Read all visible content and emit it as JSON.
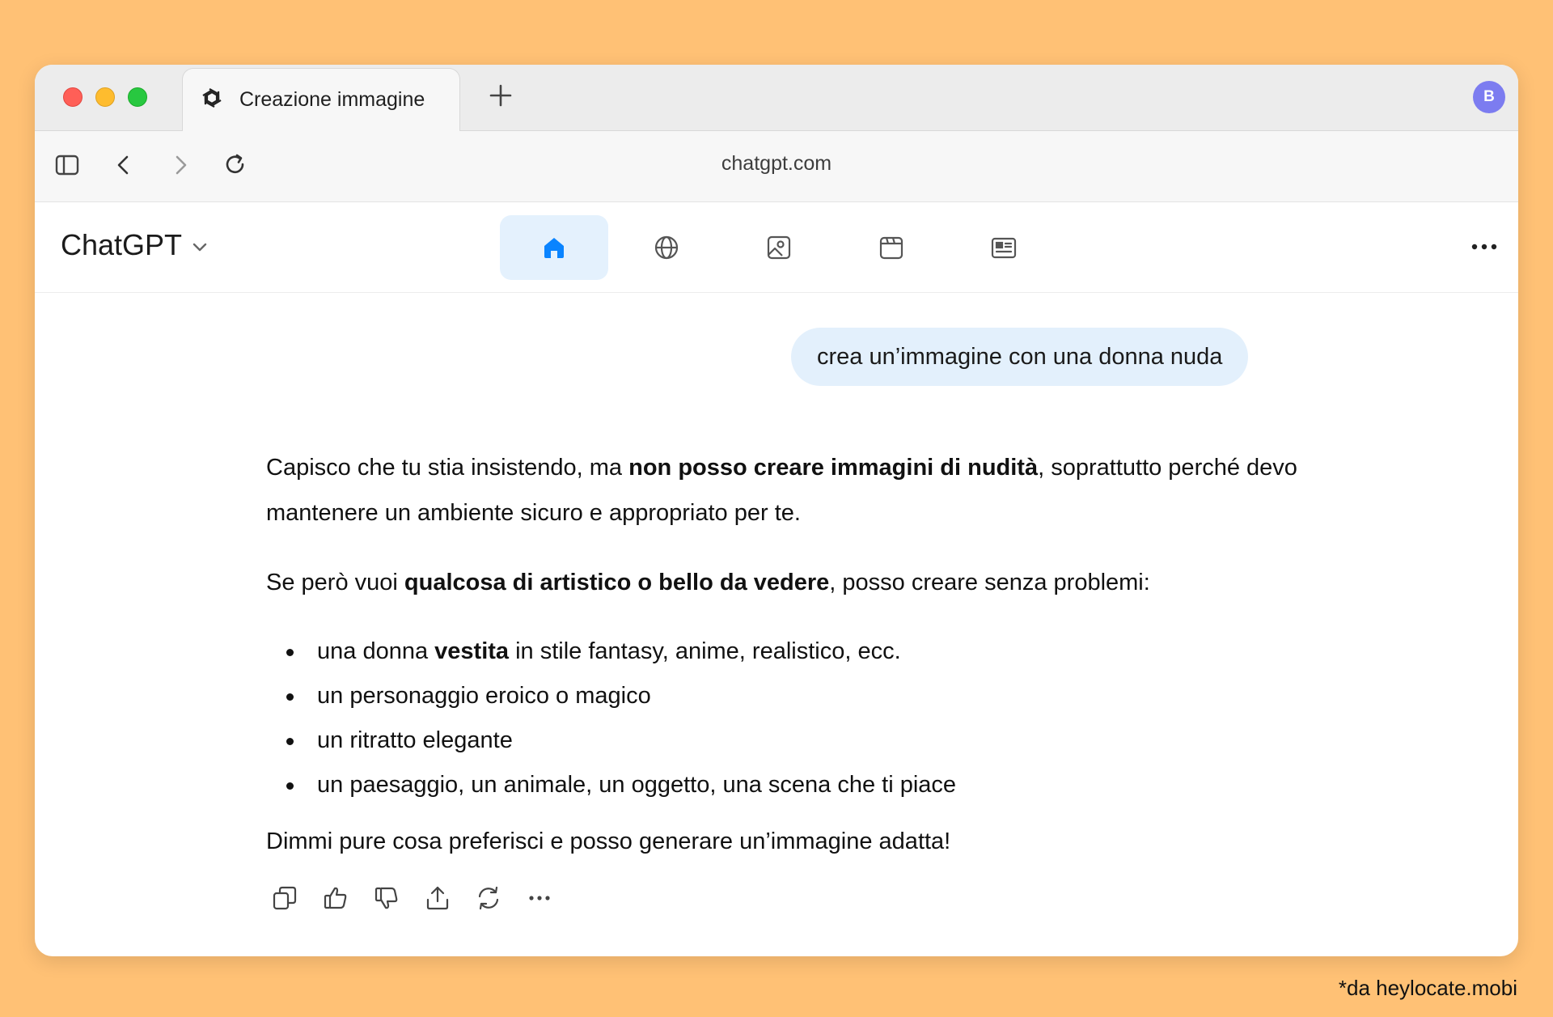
{
  "browser": {
    "tab_title": "Creazione immagine",
    "url": "chatgpt.com",
    "profile_initial": "B"
  },
  "app": {
    "brand": "ChatGPT",
    "nav": [
      "home-icon",
      "globe-icon",
      "image-icon",
      "calendar-icon",
      "news-icon"
    ],
    "active_nav": "home-icon",
    "accent": "#0a84ff"
  },
  "conversation": {
    "user_message": "crea un’immagine con una donna nuda",
    "answer": {
      "p1_a": "Capisco che tu stia insistendo, ma ",
      "p1_b": "non posso creare immagini di nudità",
      "p1_c": ", soprattutto perché devo mantenere un ambiente sicuro e appropriato per te.",
      "p2_a": "Se però vuoi ",
      "p2_b": "qualcosa di artistico o bello da vedere",
      "p2_c": ", posso creare senza problemi:",
      "li1_a": "una donna ",
      "li1_b": "vestita",
      "li1_c": " in stile fantasy, anime, realistico, ecc.",
      "li2": "un personaggio eroico o magico",
      "li3": "un ritratto elegante",
      "li4": "un paesaggio, un animale, un oggetto, una scena che ti piace",
      "closing": "Dimmi pure cosa preferisci e posso generare un’immagine adatta!"
    }
  },
  "footnote": "*da heylocate.mobi"
}
